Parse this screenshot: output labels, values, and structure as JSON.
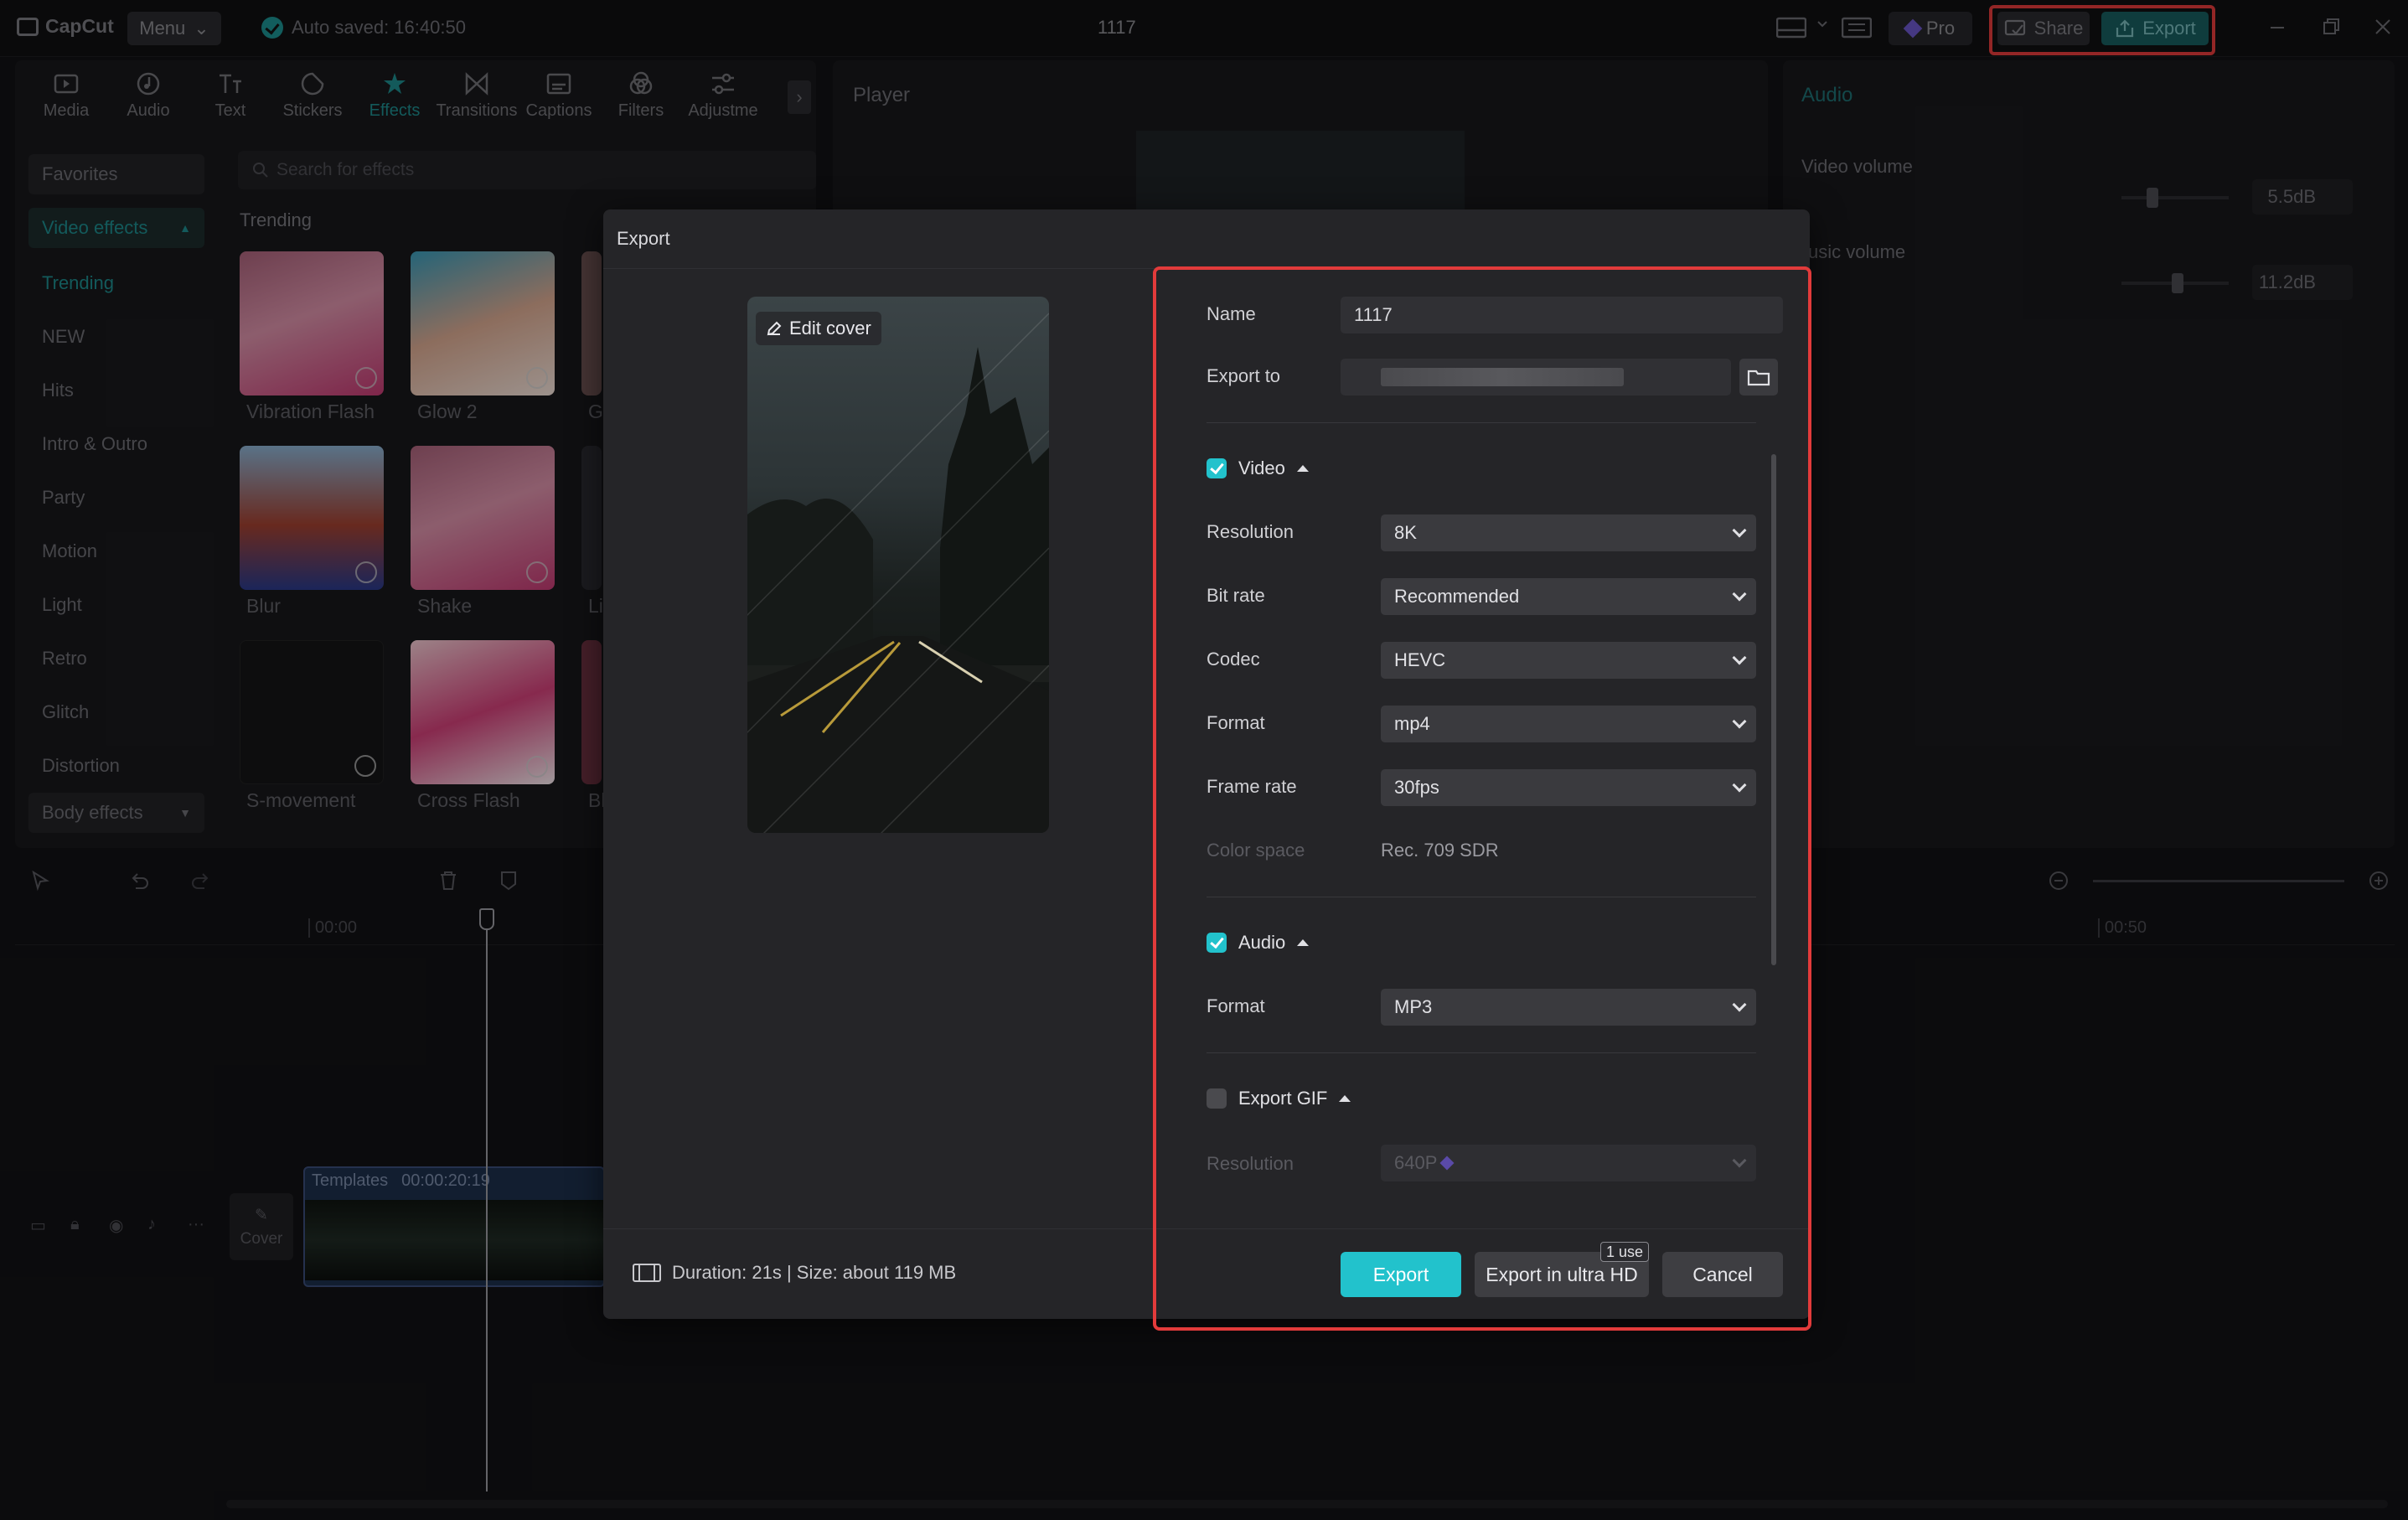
{
  "app": {
    "name": "CapCut",
    "menu_label": "Menu",
    "autosave": "Auto saved: 16:40:50",
    "project_title": "1117",
    "pro_label": "Pro",
    "share_label": "Share",
    "export_label": "Export",
    "accent_color": "#22c2cc",
    "highlight_color": "#e23b3b"
  },
  "toolbar": {
    "tabs": [
      {
        "label": "Media",
        "icon": "media-icon"
      },
      {
        "label": "Audio",
        "icon": "audio-icon"
      },
      {
        "label": "Text",
        "icon": "text-icon"
      },
      {
        "label": "Stickers",
        "icon": "stickers-icon"
      },
      {
        "label": "Effects",
        "icon": "effects-icon",
        "active": true
      },
      {
        "label": "Transitions",
        "icon": "transitions-icon"
      },
      {
        "label": "Captions",
        "icon": "captions-icon"
      },
      {
        "label": "Filters",
        "icon": "filters-icon"
      },
      {
        "label": "Adjustme",
        "icon": "adjustment-icon"
      }
    ]
  },
  "sidebar": {
    "favorites": "Favorites",
    "video_effects": "Video effects",
    "items": [
      "Trending",
      "NEW",
      "Hits",
      "Intro & Outro",
      "Party",
      "Motion",
      "Light",
      "Retro",
      "Glitch",
      "Distortion"
    ],
    "body_effects": "Body effects"
  },
  "effects": {
    "search_placeholder": "Search for effects",
    "section": "Trending",
    "items": [
      "Vibration Flash",
      "Glow 2",
      "Blur",
      "Shake",
      "S-movement",
      "Cross Flash"
    ],
    "partial_labels": [
      "G",
      "Li",
      "Bl"
    ]
  },
  "player": {
    "title": "Player"
  },
  "audio_panel": {
    "title": "Audio",
    "video_volume_label": "Video volume",
    "video_volume_value": "5.5dB",
    "video_volume_level": 0.26,
    "music_volume_label": "usic volume",
    "music_volume_value": "11.2dB",
    "music_volume_level": 0.53
  },
  "timeline": {
    "start_time": "00:00",
    "end_time": "00:50",
    "cover_label": "Cover",
    "clip_name": "Templates",
    "clip_duration": "00:00:20:19"
  },
  "export_dialog": {
    "title": "Export",
    "edit_cover": "Edit cover",
    "name_label": "Name",
    "name_value": "1117",
    "export_to_label": "Export to",
    "video": {
      "label": "Video",
      "enabled": true,
      "resolution_label": "Resolution",
      "resolution": "8K",
      "bitrate_label": "Bit rate",
      "bitrate": "Recommended",
      "codec_label": "Codec",
      "codec": "HEVC",
      "format_label": "Format",
      "format": "mp4",
      "framerate_label": "Frame rate",
      "framerate": "30fps",
      "colorspace_label": "Color space",
      "colorspace": "Rec. 709 SDR"
    },
    "audio": {
      "label": "Audio",
      "enabled": true,
      "format_label": "Format",
      "format": "MP3"
    },
    "gif": {
      "label": "Export GIF",
      "enabled": false,
      "resolution_label": "Resolution",
      "resolution": "640P"
    },
    "duration_info": "Duration: 21s | Size: about 119 MB",
    "export_button": "Export",
    "ultra_button": "Export in ultra HD",
    "ultra_badge": "1 use",
    "cancel_button": "Cancel"
  }
}
